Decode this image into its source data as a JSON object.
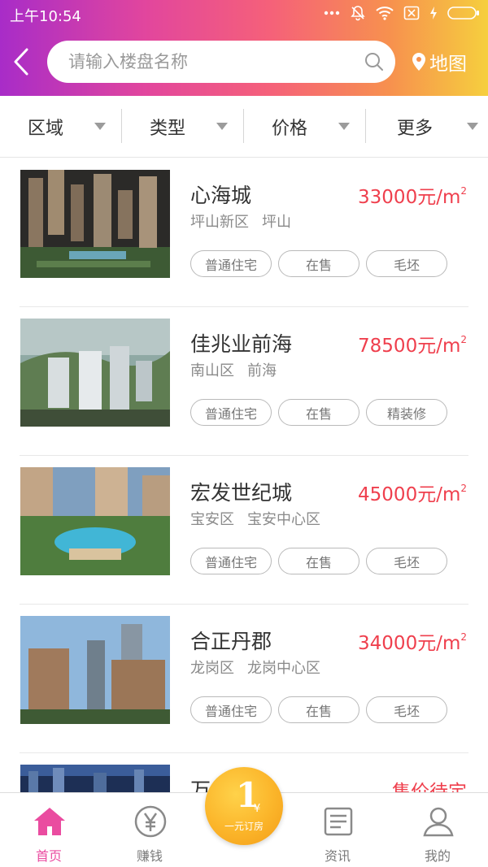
{
  "status_bar": {
    "time": "上午10:54"
  },
  "header": {
    "search_placeholder": "请输入楼盘名称",
    "map_label": "地图"
  },
  "filters": [
    {
      "label": "区域"
    },
    {
      "label": "类型"
    },
    {
      "label": "价格"
    },
    {
      "label": "更多"
    }
  ],
  "listings": [
    {
      "name": "心海城",
      "price": "33000元/m",
      "district": "坪山新区",
      "area": "坪山",
      "tags": [
        "普通住宅",
        "在售",
        "毛坯"
      ]
    },
    {
      "name": "佳兆业前海",
      "price": "78500元/m",
      "district": "南山区",
      "area": "前海",
      "tags": [
        "普通住宅",
        "在售",
        "精装修"
      ]
    },
    {
      "name": "宏发世纪城",
      "price": "45000元/m",
      "district": "宝安区",
      "area": "宝安中心区",
      "tags": [
        "普通住宅",
        "在售",
        "毛坯"
      ]
    },
    {
      "name": "合正丹郡",
      "price": "34000元/m",
      "district": "龙岗区",
      "area": "龙岗中心区",
      "tags": [
        "普通住宅",
        "在售",
        "毛坯"
      ]
    },
    {
      "name": "万",
      "price": "售价待定",
      "district": "",
      "area": "",
      "tags": []
    }
  ],
  "price_unit_sup": "2",
  "bottom_nav": {
    "home": "首页",
    "earn": "赚钱",
    "order_number": "1",
    "order_currency": "¥",
    "order_label": "一元订房",
    "news": "资讯",
    "mine": "我的"
  },
  "colors": {
    "accent_pink": "#ea4ca0",
    "price_red": "#ef3f4d",
    "gold": "#fbb52a"
  }
}
